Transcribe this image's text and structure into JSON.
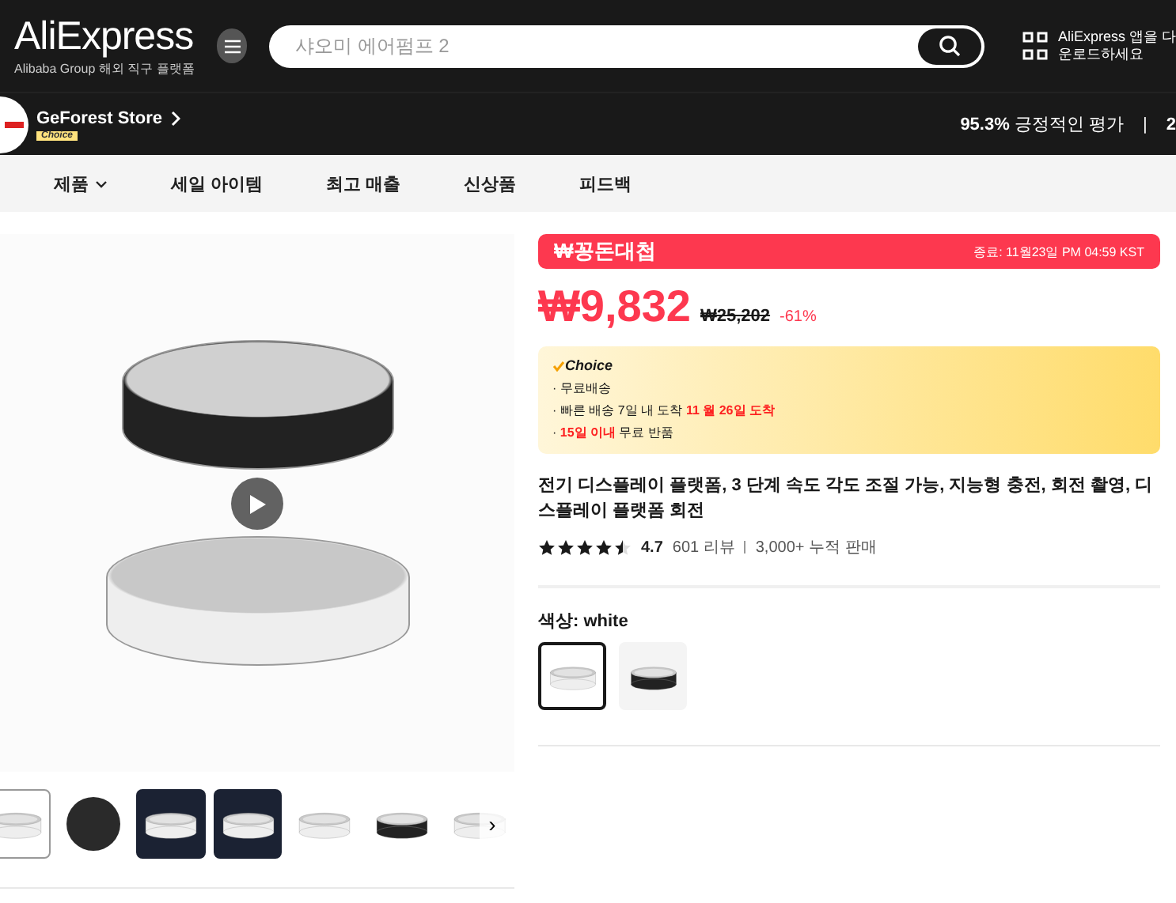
{
  "header": {
    "logo": "AliExpress",
    "tagline": "Alibaba Group 해외 직구 플랫폼",
    "search": {
      "placeholder": "샤오미 에어펌프 2"
    },
    "app_promo": [
      "AliExpress 앱을 다",
      "운로드하세요"
    ]
  },
  "store": {
    "name": "GeForest Store",
    "badge": "Choice",
    "rating_value": "95.3%",
    "rating_label": "긍정적인 평가",
    "separator": "|",
    "next_stat": "2"
  },
  "nav": [
    {
      "label": "제품",
      "dropdown": true
    },
    {
      "label": "세일 아이템",
      "dropdown": false
    },
    {
      "label": "최고 매출",
      "dropdown": false
    },
    {
      "label": "신상품",
      "dropdown": false
    },
    {
      "label": "피드백",
      "dropdown": false
    }
  ],
  "gallery": {
    "thumbnails": [
      {
        "kind": "white",
        "selected": true
      },
      {
        "kind": "round",
        "selected": false
      },
      {
        "kind": "dark",
        "selected": false
      },
      {
        "kind": "dark",
        "selected": false
      },
      {
        "kind": "white",
        "selected": false
      },
      {
        "kind": "black",
        "selected": false
      },
      {
        "kind": "white",
        "selected": false
      }
    ],
    "next": "›"
  },
  "deal": {
    "title": "₩꽁돈대첩",
    "ends": "종료: 11월23일 PM 04:59 KST"
  },
  "price": {
    "current": "₩9,832",
    "original": "₩25,202",
    "discount": "-61%"
  },
  "choice": {
    "label": "Choice",
    "lines": [
      "· 무료배송",
      "· 빠른 배송 7일 내 도착 **11 월 26일 도착**",
      "· **15일 이내** 무료 반품"
    ]
  },
  "product": {
    "title": "전기 디스플레이 플랫폼, 3 단계 속도 각도 조절 가능, 지능형 충전, 회전 촬영, 디스플레이 플랫폼 회전",
    "stars": 4.5,
    "rating": "4.7",
    "reviews": "601 리뷰",
    "sold": "3,000+ 누적 판매"
  },
  "color": {
    "label": "색상: white",
    "options": [
      {
        "kind": "white",
        "selected": true
      },
      {
        "kind": "black",
        "selected": false
      }
    ]
  }
}
